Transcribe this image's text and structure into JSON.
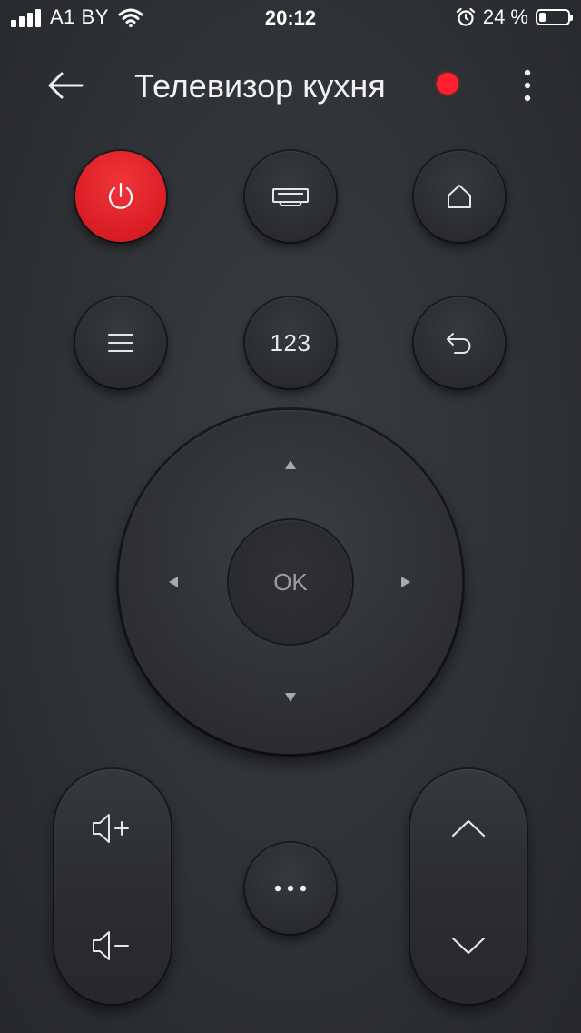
{
  "status_bar": {
    "carrier": "A1 BY",
    "time": "20:12",
    "battery_percent": "24 %",
    "battery_level": 0.24,
    "icons": [
      "signal-icon",
      "wifi-icon",
      "alarm-icon",
      "battery-icon"
    ]
  },
  "header": {
    "title": "Телевизор кухня",
    "back_icon": "arrow-left-icon",
    "more_icon": "more-vertical-icon",
    "status_color": "#ff1f2f"
  },
  "buttons": {
    "power_icon": "power-icon",
    "input_icon": "input-source-icon",
    "home_icon": "home-icon",
    "menu_icon": "menu-icon",
    "numbers_label": "123",
    "return_icon": "return-icon",
    "ok_label": "OK",
    "more_icon": "ellipsis-icon",
    "vol_up_icon": "volume-up-icon",
    "vol_down_icon": "volume-down-icon",
    "ch_up_icon": "chevron-up-icon",
    "ch_down_icon": "chevron-down-icon"
  },
  "colors": {
    "power_button": "#e0262c",
    "background": "#2f3236",
    "accent_dot": "#ff1f2f"
  }
}
